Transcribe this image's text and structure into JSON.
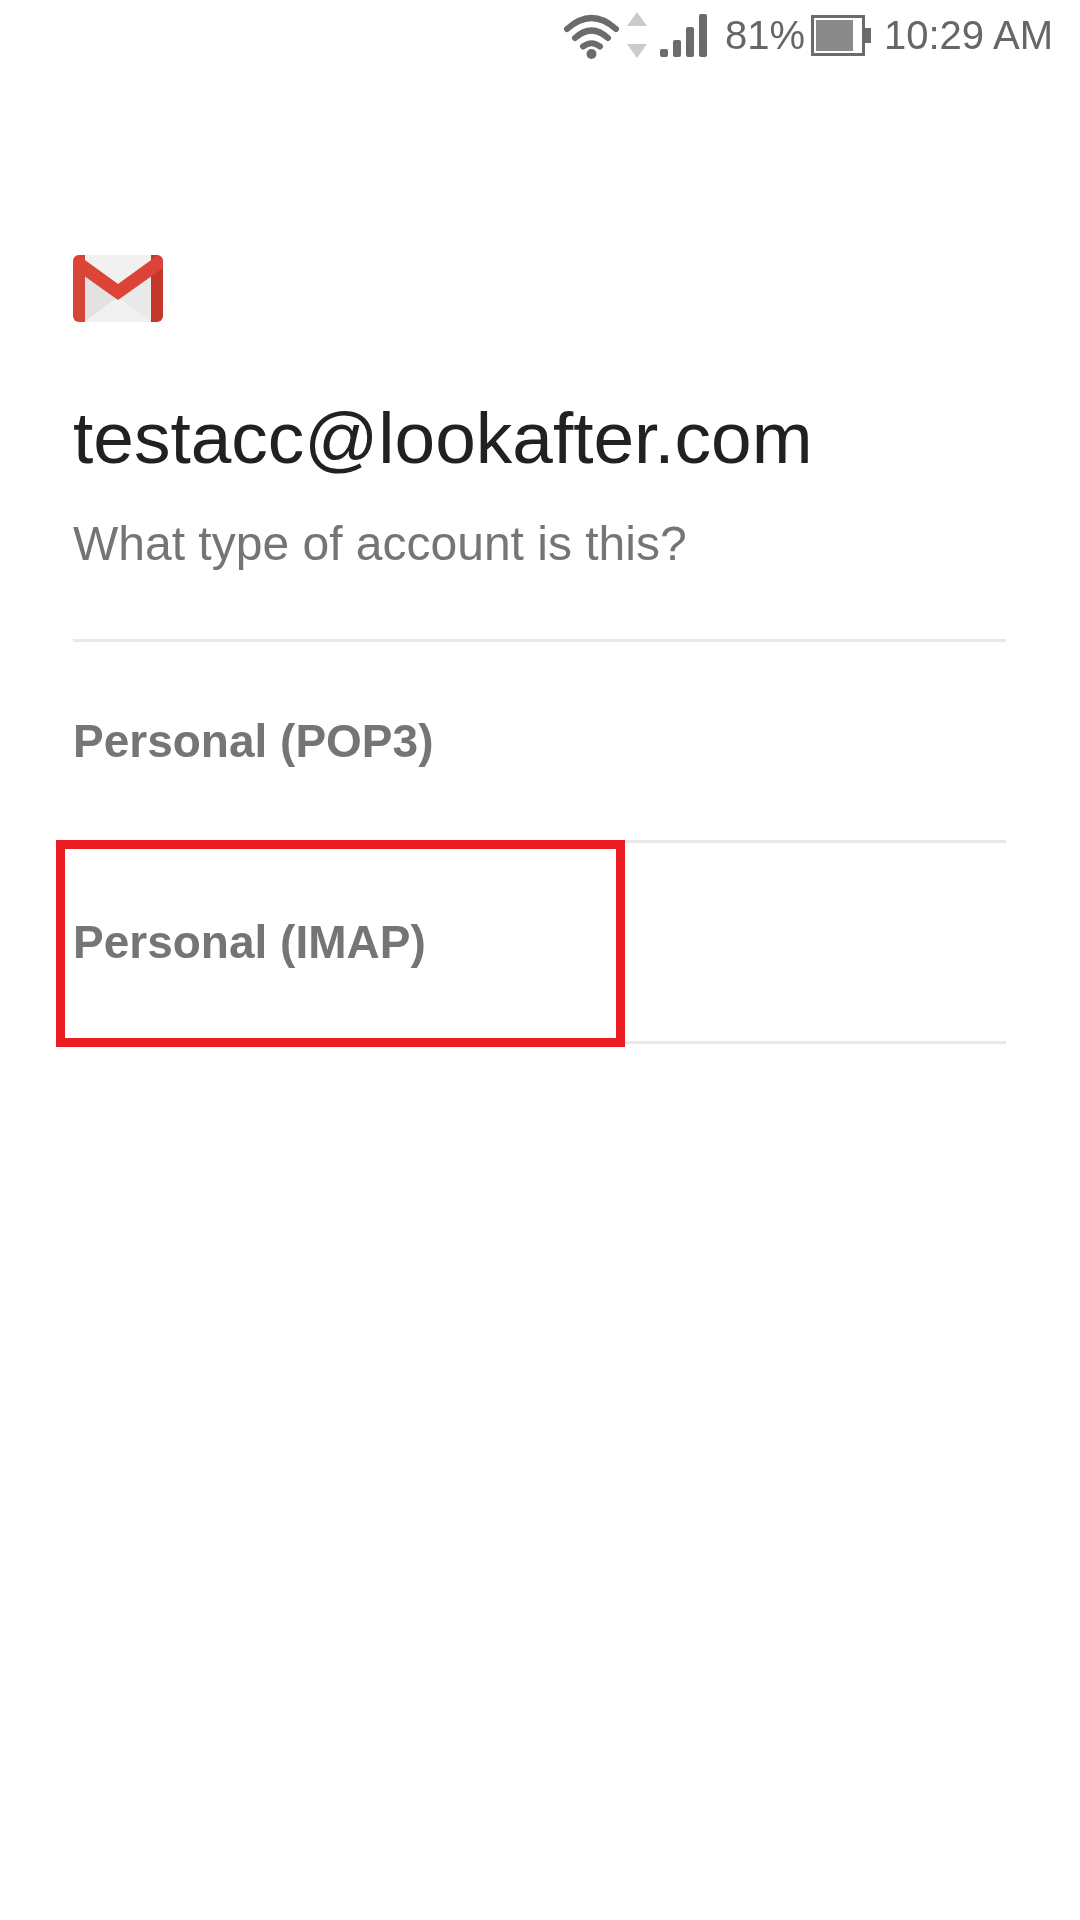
{
  "status_bar": {
    "battery_percent": "81%",
    "time": "10:29 AM"
  },
  "header": {
    "account": "testacc@lookafter.com",
    "prompt": "What type of account is this?"
  },
  "options": [
    {
      "label": "Personal (POP3)",
      "highlighted": false
    },
    {
      "label": "Personal (IMAP)",
      "highlighted": true
    }
  ]
}
